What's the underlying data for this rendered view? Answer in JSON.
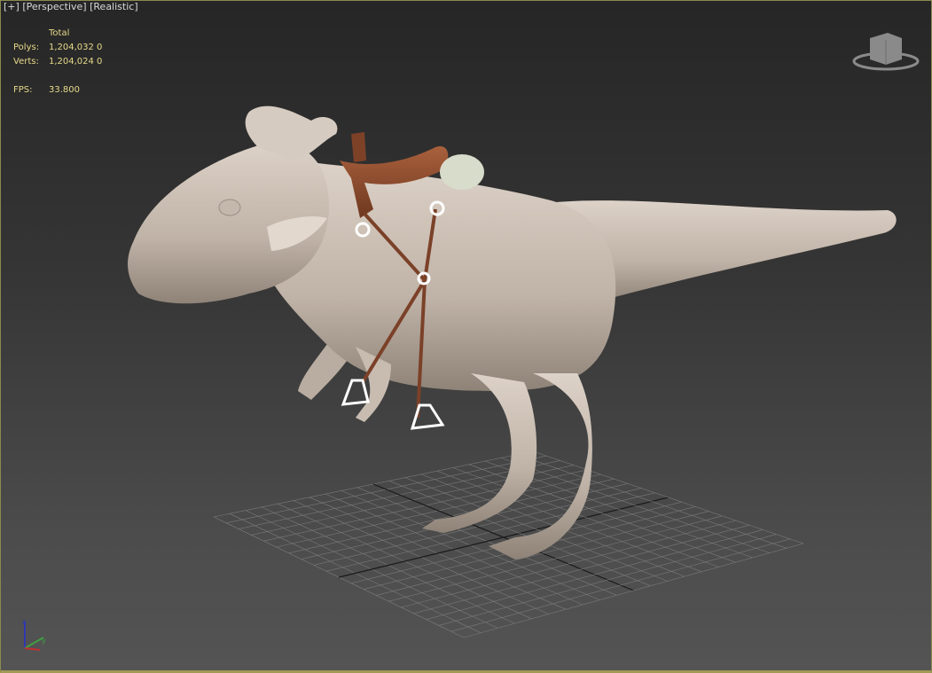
{
  "viewport": {
    "labels": [
      "[+]",
      "[Perspective]",
      "[Realistic]"
    ],
    "stats": {
      "header": "Total",
      "polys_label": "Polys:",
      "polys_value": "1,204,032",
      "polys_sel": "0",
      "verts_label": "Verts:",
      "verts_value": "1,204,024",
      "verts_sel": "0",
      "fps_label": "FPS:",
      "fps_value": "33.800"
    },
    "viewcube_icon": "viewcube-icon",
    "axis_tripod": {
      "z": "z",
      "y": "y",
      "x": "x"
    },
    "colors": {
      "border_active": "#a09a55",
      "stats_text": "#e6d98a",
      "model": "#cfc3b8",
      "saddle": "#8a4a2e"
    }
  }
}
